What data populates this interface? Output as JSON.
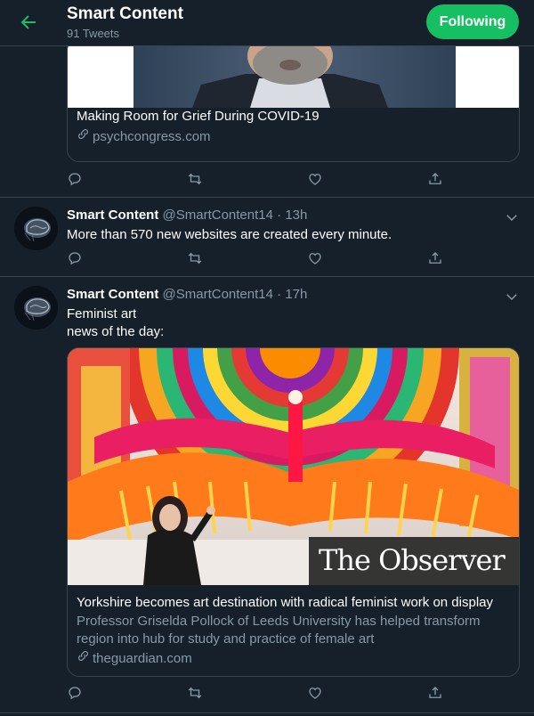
{
  "header": {
    "title": "Smart Content",
    "subtitle": "91 Tweets",
    "follow_label": "Following",
    "accent": "#17bf63"
  },
  "tweets": [
    {
      "card": {
        "title": "Making Room for Grief During COVID-19",
        "domain": "psychcongress.com"
      }
    },
    {
      "name": "Smart Content",
      "handle": "@SmartContent14",
      "dot": "·",
      "time": "13h",
      "text": "More than 570 new websites are created every minute."
    },
    {
      "name": "Smart Content",
      "handle": "@SmartContent14",
      "dot": "·",
      "time": "17h",
      "text_line1": "Feminist art",
      "text_line2": "news of the day:",
      "card": {
        "image_caption": "The Observer",
        "title": "Yorkshire becomes art destination with radical feminist work on display",
        "desc": "Professor Griselda Pollock of Leeds University has helped transform region into hub for study and practice of female art",
        "domain": "theguardian.com"
      }
    }
  ],
  "icons": [
    "back-arrow-icon",
    "reply-icon",
    "retweet-icon",
    "like-icon",
    "share-icon",
    "chevron-down-icon",
    "link-icon"
  ]
}
